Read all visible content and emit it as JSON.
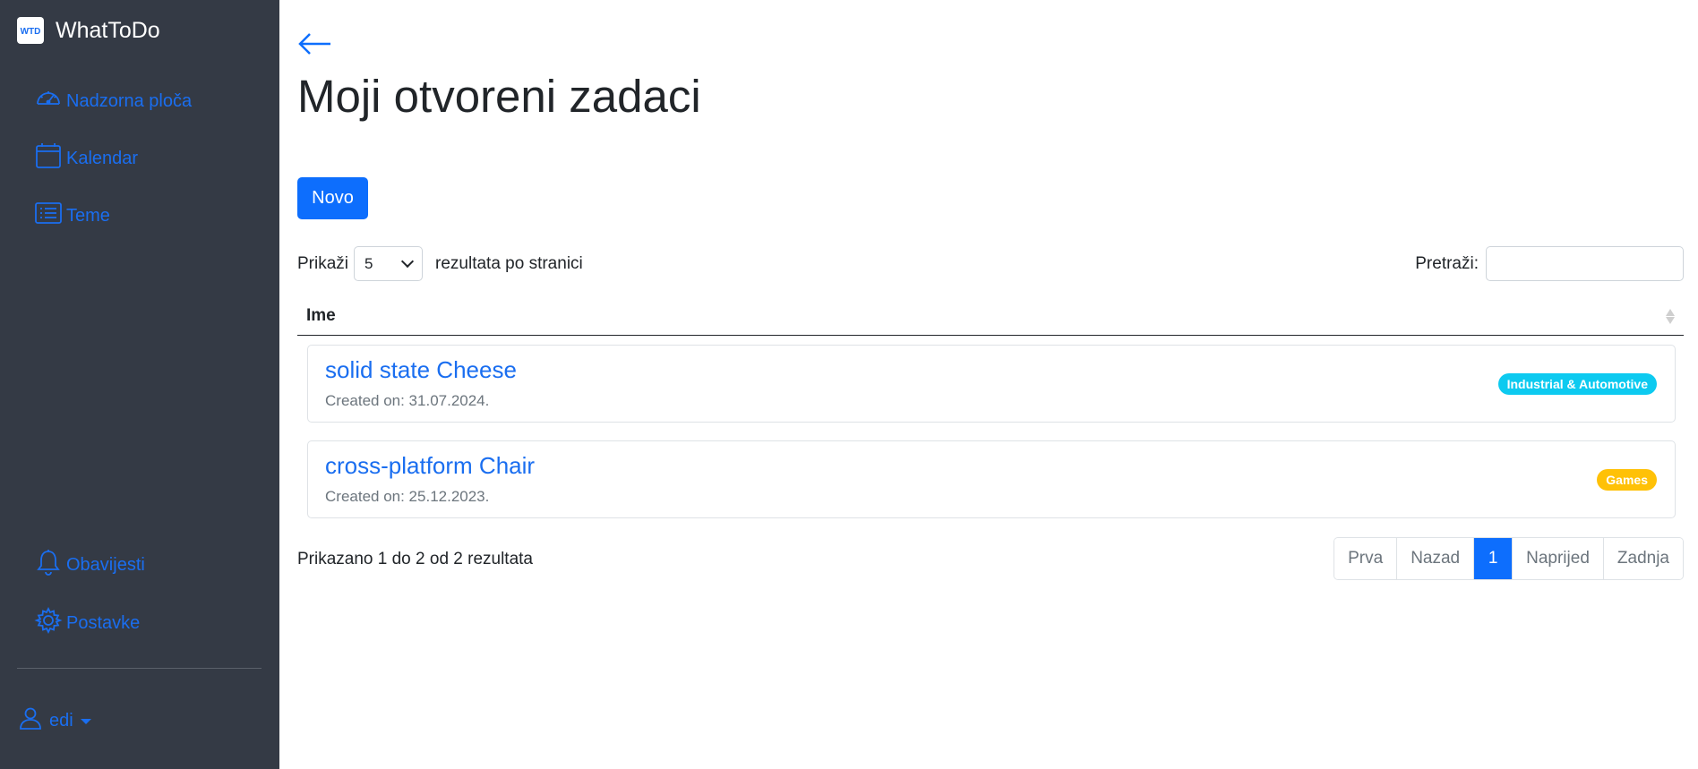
{
  "app": {
    "brand_name": "WhatToDo",
    "logo_text": "WTD"
  },
  "sidebar": {
    "nav": [
      {
        "label": "Nadzorna ploča",
        "icon": "speedometer-icon"
      },
      {
        "label": "Kalendar",
        "icon": "calendar-icon"
      },
      {
        "label": "Teme",
        "icon": "list-icon"
      }
    ],
    "bottom_nav": [
      {
        "label": "Obavijesti",
        "icon": "bell-icon"
      },
      {
        "label": "Postavke",
        "icon": "gear-icon"
      }
    ],
    "user": {
      "name": "edi",
      "icon": "user-icon"
    }
  },
  "main": {
    "title": "Moji otvoreni zadaci",
    "new_button": "Novo",
    "length": {
      "prefix": "Prikaži",
      "value": "5",
      "suffix": "rezultata po stranici"
    },
    "search": {
      "label": "Pretraži:",
      "value": ""
    },
    "table": {
      "column": "Ime",
      "rows": [
        {
          "title": "solid state Cheese",
          "created": "Created on: 31.07.2024.",
          "tag": "Industrial & Automotive",
          "tag_color": "#0dcaf0"
        },
        {
          "title": "cross-platform Chair",
          "created": "Created on: 25.12.2023.",
          "tag": "Games",
          "tag_color": "#ffc107"
        }
      ]
    },
    "info": "Prikazano 1 do 2 od 2 rezultata",
    "pagination": {
      "first": "Prva",
      "prev": "Nazad",
      "current": "1",
      "next": "Naprijed",
      "last": "Zadnja"
    }
  },
  "colors": {
    "sidebar_bg": "#343a45",
    "accent": "#0d6efd",
    "link": "#1a6ef0"
  }
}
